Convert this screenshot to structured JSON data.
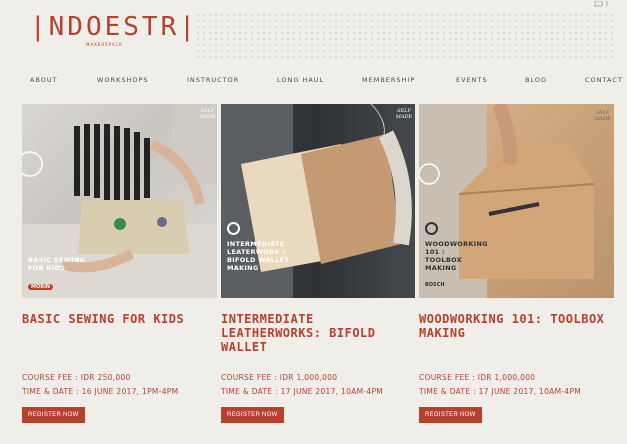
{
  "header": {
    "logo": "|NDOESTR|",
    "logo_sub": "MAKERSPACE"
  },
  "nav": [
    "ABOUT",
    "WORKSHOPS",
    "INSTRUCTOR",
    "LONG HAUL",
    "MEMBERSHIP",
    "EVENTS",
    "BLOG",
    "CONTACT"
  ],
  "cards": [
    {
      "overlay": "BASIC SEWING\nFOR KIDS",
      "brand": "MORIN",
      "self_made": "SELF\nMADE",
      "title": "BASIC SEWING FOR KIDS",
      "fee": "COURSE FEE : IDR 250,000",
      "date": "TIME & DATE : 16 JUNE 2017, 1PM-4PM",
      "button": "REGISTER NOW"
    },
    {
      "overlay": "INTERMEDIATE\nLEATERWORK :\nBIFOLD WALLET\nMAKING",
      "self_made": "SELF\nMADE",
      "title": "INTERMEDIATE LEATHERWORKS: BIFOLD WALLET",
      "fee": "COURSE FEE : IDR 1,000,000",
      "date": "TIME & DATE : 17 JUNE 2017, 10AM-4PM",
      "button": "REGISTER NOW"
    },
    {
      "overlay": "WOODWORKING\n101 :\nTOOLBOX\nMAKING",
      "brand": "BOSCH",
      "self_made": "SELF\nMADE",
      "title": "WOODWORKING 101: TOOLBOX MAKING",
      "fee": "COURSE FEE : IDR 1,000,000",
      "date": "TIME & DATE : 17 JUNE 2017, 10AM-4PM",
      "button": "REGISTER NOW"
    }
  ],
  "colors": {
    "accent": "#b8402f",
    "background": "#efeee9"
  }
}
